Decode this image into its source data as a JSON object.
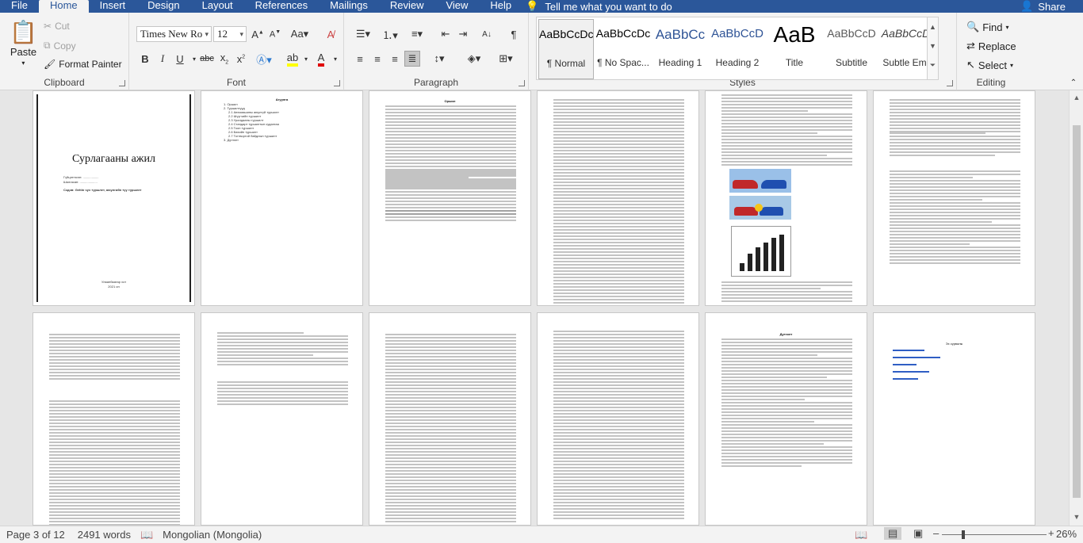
{
  "menu": {
    "tabs": [
      "File",
      "Home",
      "Insert",
      "Design",
      "Layout",
      "References",
      "Mailings",
      "Review",
      "View",
      "Help"
    ],
    "active_tab": "Home",
    "tell_me": "Tell me what you want to do",
    "share": "Share"
  },
  "clipboard": {
    "paste": "Paste",
    "cut": "Cut",
    "copy": "Copy",
    "format_painter": "Format Painter",
    "label": "Clipboard"
  },
  "font": {
    "family": "Times New Ro",
    "size": "12",
    "label": "Font"
  },
  "paragraph": {
    "label": "Paragraph"
  },
  "styles": {
    "label": "Styles",
    "items": [
      {
        "preview": "AaBbCcDc",
        "name": "¶ Normal"
      },
      {
        "preview": "AaBbCcDc",
        "name": "¶ No Spac..."
      },
      {
        "preview": "AaBbCc",
        "name": "Heading 1"
      },
      {
        "preview": "AaBbCcD",
        "name": "Heading 2"
      },
      {
        "preview": "AaB",
        "name": "Title"
      },
      {
        "preview": "AaBbCcD",
        "name": "Subtitle"
      },
      {
        "preview": "AaBbCcDc",
        "name": "Subtle Em..."
      }
    ]
  },
  "editing": {
    "find": "Find",
    "replace": "Replace",
    "select": "Select",
    "label": "Editing"
  },
  "document": {
    "cover_title": "Сурлагааны ажил",
    "cover_line1": "Гүйцэтгэсэн: ..................",
    "cover_line2": "Шалгасан: ....................",
    "cover_subject": "Сэдэв: Gettin чух туршлет, аюулгийн түү туршлет",
    "cover_footer1": "Улаанбаатар хот",
    "cover_footer2": "2021 он",
    "toc_title": "Агуулга",
    "toc_items": [
      "1. Оршил",
      "2. Туршилтууд",
      "2.1 Автомашины аюулгүй туршилт",
      "2.2 Шүүгчийн туршилт",
      "2.3 Уралдааны туршилт",
      "2.4 Стандарт туршилтын судалгаа",
      "2.5 Тоон туршилт",
      "2.6 Бөхийн туршилт",
      "2.7 Тогтвортой байдлын туршилт",
      "3. Дүгнэлт"
    ],
    "intro_title": "Оршил",
    "conclusion_title": "Дүгнэлт",
    "refs_title": "Эх сурвалж"
  },
  "status": {
    "page": "Page 3 of 12",
    "words": "2491 words",
    "language": "Mongolian (Mongolia)",
    "zoom": "26%"
  },
  "colors": {
    "accent": "#2b579a"
  }
}
